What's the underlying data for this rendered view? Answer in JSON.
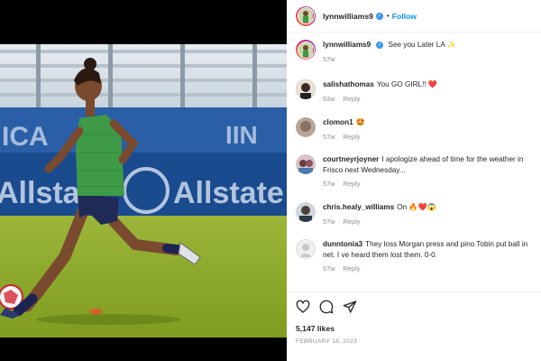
{
  "post": {
    "author": "lynnwilliams9",
    "follow_label": "Follow",
    "dot": "•",
    "caption_author": "lynnwilliams9",
    "caption_text": "See you Later LA ✨",
    "caption_time": "57w",
    "likes": "5,147 likes",
    "date": "FEBRUARY 18, 2023"
  },
  "media": {
    "banner_text_1": "ICA",
    "banner_text_2": "Allstate",
    "banner_text_3": "Allstate",
    "banner_text_4": "IIN"
  },
  "comments": [
    {
      "user": "salishathomas",
      "text": "You GO GIRL!! ❤️",
      "time": "53w",
      "reply": "Reply"
    },
    {
      "user": "clomon1",
      "text": "🤩",
      "time": "57w",
      "reply": "Reply"
    },
    {
      "user": "courtneyrjoyner",
      "text": "I apologize ahead of time for the weather in",
      "text2": "Frisco next Wednesday...",
      "time": "57w",
      "reply": "Reply"
    },
    {
      "user": "chris.healy_williams",
      "text": "On 🔥❤️😱",
      "time": "57w",
      "reply": "Reply"
    },
    {
      "user": "dunntonia3",
      "text": "They loss Morgan press and pino Tobin put ball in",
      "text2": "net. I ve heard them lost them. 0-0.",
      "time": "57w",
      "reply": "Reply"
    }
  ],
  "icons": [
    "heart-icon",
    "comment-icon",
    "share-icon",
    "verified-icon"
  ],
  "colors": {
    "follow": "#0095f6",
    "verified": "#3897f0",
    "meta": "#8e8e8e",
    "jersey": "#3e9a46",
    "shorts": "#1f2a55"
  }
}
